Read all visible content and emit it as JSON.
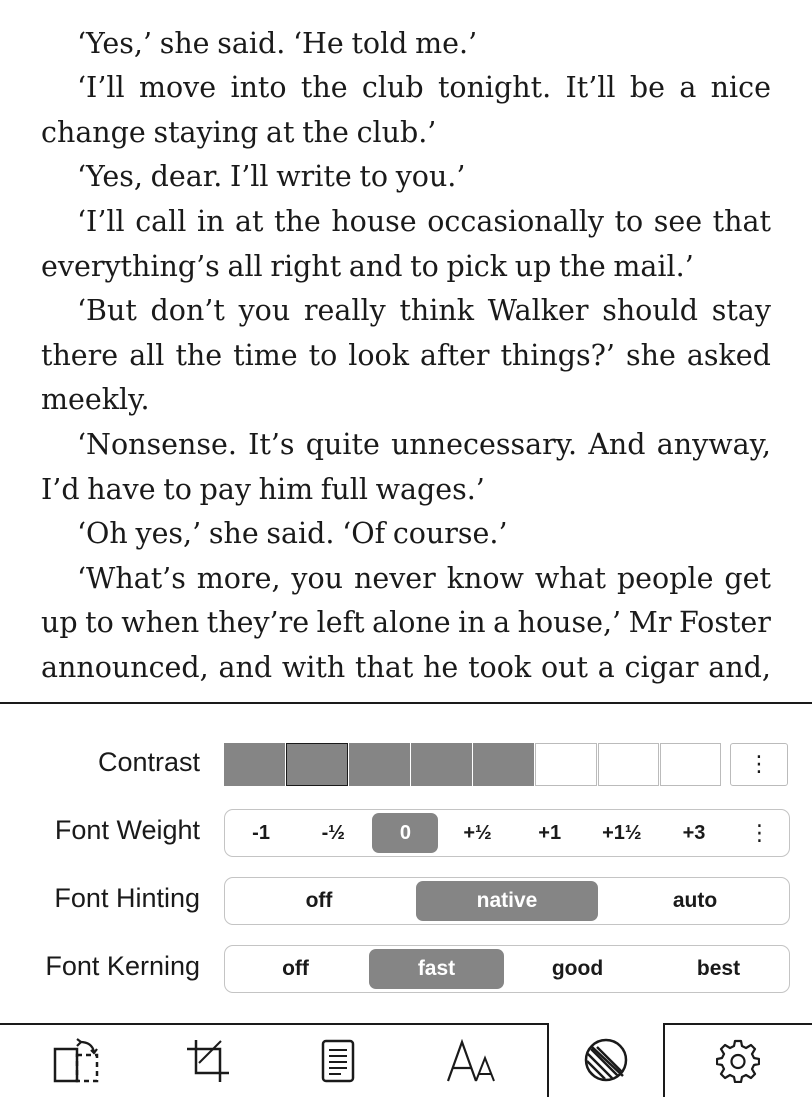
{
  "reader": {
    "lines": [
      {
        "text": "‘Yes,’ she said. ‘He told me.’",
        "indent": true,
        "last": true
      },
      {
        "text": "‘I’ll move into the club tonight. It’ll be a nice",
        "indent": true,
        "last": false
      },
      {
        "text": "change staying at the club.’",
        "indent": false,
        "last": true
      },
      {
        "text": "‘Yes, dear. I’ll write to you.’",
        "indent": true,
        "last": true
      },
      {
        "text": "‘I’ll call in at the house occasionally to see that",
        "indent": true,
        "last": false
      },
      {
        "text": "everything’s all right and to pick up the mail.’",
        "indent": false,
        "last": true
      },
      {
        "text": "‘But don’t you really think Walker should stay",
        "indent": true,
        "last": false
      },
      {
        "text": "there all the time to look after things?’ she asked",
        "indent": false,
        "last": false
      },
      {
        "text": "meekly.",
        "indent": false,
        "last": true
      },
      {
        "text": "‘Nonsense. It’s quite unnecessary. And anyway,",
        "indent": true,
        "last": false
      },
      {
        "text": "I’d have to pay him full wages.’",
        "indent": false,
        "last": true
      },
      {
        "text": "‘Oh yes,’ she said. ‘Of course.’",
        "indent": true,
        "last": true
      },
      {
        "text": "‘What’s more, you never know what people get",
        "indent": true,
        "last": false
      },
      {
        "text": "up to when they’re left alone in a house,’ Mr Foster",
        "indent": false,
        "last": false
      },
      {
        "text": "announced, and with that he took out a cigar and,",
        "indent": false,
        "last": false
      }
    ]
  },
  "settings": {
    "contrast": {
      "label": "Contrast",
      "filled_cells": 5,
      "total_cells": 8,
      "selected_cell": 1,
      "more_label": "⋮"
    },
    "font_weight": {
      "label": "Font Weight",
      "options": [
        "-1",
        "-½",
        "0",
        "+½",
        "+1",
        "+1½",
        "+3"
      ],
      "selected": "0",
      "more_label": "⋮"
    },
    "font_hinting": {
      "label": "Font Hinting",
      "options": [
        "off",
        "native",
        "auto"
      ],
      "selected": "native"
    },
    "font_kerning": {
      "label": "Font Kerning",
      "options": [
        "off",
        "fast",
        "good",
        "best"
      ],
      "selected": "fast"
    }
  },
  "toolbar": {
    "items": [
      {
        "name": "page-orientation-icon"
      },
      {
        "name": "crop-icon"
      },
      {
        "name": "document-icon"
      },
      {
        "name": "font-size-icon"
      },
      {
        "name": "contrast-icon",
        "active": true
      },
      {
        "name": "gear-icon"
      }
    ]
  },
  "colors": {
    "selected_fill": "#858585",
    "text": "#1a1a1a",
    "border": "#c4c4c4"
  }
}
